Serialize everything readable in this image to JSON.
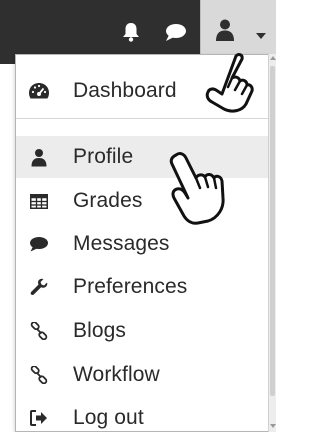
{
  "navbar": {
    "icons": {
      "notifications": "bell-icon",
      "messages": "speech-bubble-icon",
      "user": "user-icon",
      "caret": "chevron-down-icon"
    },
    "colors": {
      "background": "#2f2f2f",
      "user_toggle": "#d9d9d9"
    }
  },
  "menu": {
    "items": [
      {
        "label": "Dashboard",
        "icon": "dashboard-gauge-icon"
      },
      {
        "label": "Profile",
        "icon": "user-icon",
        "active": true
      },
      {
        "label": "Grades",
        "icon": "table-grid-icon"
      },
      {
        "label": "Messages",
        "icon": "speech-bubble-icon"
      },
      {
        "label": "Preferences",
        "icon": "wrench-icon"
      },
      {
        "label": "Blogs",
        "icon": "link-chain-icon"
      },
      {
        "label": "Workflow",
        "icon": "link-chain-icon"
      },
      {
        "label": "Log out",
        "icon": "sign-out-icon"
      }
    ],
    "colors": {
      "active_background": "#ececec",
      "text": "#2a2a2a"
    }
  },
  "annotations": {
    "pointer": "pointing-hand-cursor-icon"
  }
}
